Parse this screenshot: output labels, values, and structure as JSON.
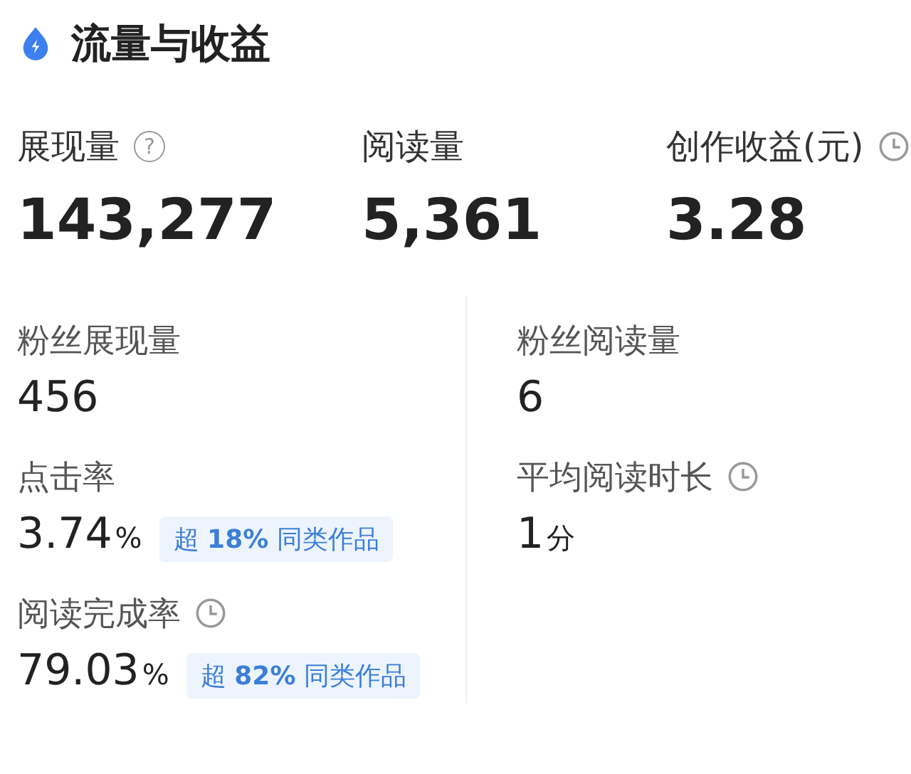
{
  "header": {
    "title": "流量与收益"
  },
  "top_stats": [
    {
      "label": "展现量",
      "kind": "help",
      "icon_text": "?",
      "value": "143,277"
    },
    {
      "label": "阅读量",
      "kind": "plain",
      "value": "5,361"
    },
    {
      "label": "创作收益(元)",
      "kind": "clock",
      "value": "3.28"
    }
  ],
  "left_stats": [
    {
      "label": "粉丝展现量",
      "kind": "plain",
      "value": "456"
    },
    {
      "label": "点击率",
      "kind": "plain",
      "value": "3.74",
      "unit": "%",
      "badge": "超 **18%** 同类作品"
    },
    {
      "label": "阅读完成率",
      "kind": "clock",
      "value": "79.03",
      "unit": "%",
      "badge": "超 **82%** 同类作品"
    }
  ],
  "right_stats": [
    {
      "label": "粉丝阅读量",
      "kind": "plain",
      "value": "6"
    },
    {
      "label": "平均阅读时长",
      "kind": "clock",
      "value": "1",
      "unit": "分"
    }
  ]
}
